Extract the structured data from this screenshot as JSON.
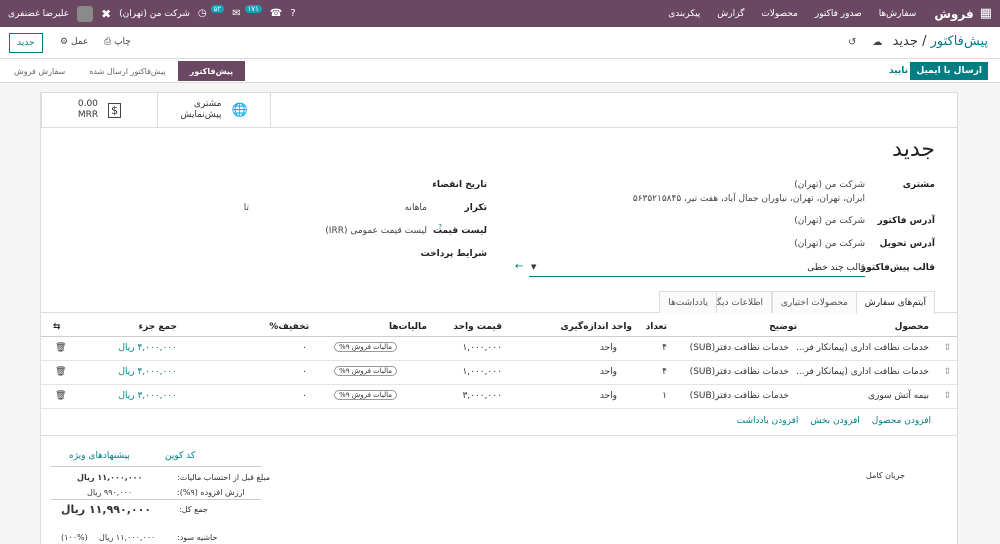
{
  "topbar": {
    "app_name": "فروش",
    "menu": [
      "سفارش‌ها",
      "صدور فاکتور",
      "محصولات",
      "گزارش",
      "پیکربندی"
    ],
    "company": "شرکت من (تهران)",
    "activity_count": "۵۲",
    "message_count": "۱۷۱",
    "user_name": "علیرضا غضنفری"
  },
  "control_panel": {
    "breadcrumb_parent": "پیش‌فاکتور",
    "breadcrumb_sep": "/",
    "breadcrumb_current": "جدید",
    "new_button": "جدید",
    "print_label": "چاپ",
    "action_label": "عمل"
  },
  "statusbar": {
    "send_email": "ارسال با ایمیل",
    "confirm": "تایید",
    "stages": [
      "پیش‌فاکتور",
      "پیش‌فاکتور ارسال شده",
      "سفارش فروش"
    ]
  },
  "smart_buttons": {
    "preview_title": "مشتری",
    "preview_sub": "پیش‌نمایش",
    "amount_value": "0.00",
    "amount_currency": "MRR"
  },
  "form": {
    "title": "جدید",
    "customer_label": "مشتری",
    "customer_value": "شرکت من (تهران)",
    "customer_address": "ایران، تهران، تهران، نیاوران جمال آباد، هفت تیر، ۵۶۳۵۲۱۵۸۴۵",
    "invoice_address_label": "آدرس فاکتور",
    "invoice_address_value": "شرکت من (تهران)",
    "delivery_address_label": "آدرس تحویل",
    "delivery_address_value": "شرکت من (تهران)",
    "template_label": "قالب پیش‌فاکتور",
    "template_value": "قالب چند خطی",
    "expiry_label": "تاریخ انقضاء",
    "recurrence_label": "تکرار",
    "recurrence_value": "ماهانه",
    "recurrence_until": "تا",
    "pricelist_label": "لیست قیمت",
    "pricelist_value": "لیست قیمت عمومی (IRR)",
    "payment_terms_label": "شرایط پرداخت"
  },
  "tabs": [
    "آیتم‌های سفارش",
    "محصولات اختیاری",
    "اطلاعات دیگر",
    "یادداشت‌ها"
  ],
  "table": {
    "headers": [
      "محصول",
      "توضیح",
      "تعداد",
      "واحد اندازه‌گیری",
      "قیمت واحد",
      "مالیات‌ها",
      "تخفیف%",
      "جمع جزء"
    ],
    "rows": [
      {
        "product": "خدمات نظافت اداری (پیمانکار فر...",
        "description": "خدمات نظافت دفتر(SUB)",
        "qty": "۴",
        "uom": "واحد",
        "price": "۱,۰۰۰,۰۰۰",
        "tax": "مالیات فروش ۹%",
        "discount": "۰",
        "subtotal": "۴,۰۰۰,۰۰۰ ریال"
      },
      {
        "product": "خدمات نظافت اداری (پیمانکار فر...",
        "description": "خدمات نظافت دفتر(SUB)",
        "qty": "۴",
        "uom": "واحد",
        "price": "۱,۰۰۰,۰۰۰",
        "tax": "مالیات فروش ۹%",
        "discount": "۰",
        "subtotal": "۴,۰۰۰,۰۰۰ ریال"
      },
      {
        "product": "بیمه آتش سوزی",
        "description": "خدمات نظافت دفتر(SUB)",
        "qty": "۱",
        "uom": "واحد",
        "price": "۳,۰۰۰,۰۰۰",
        "tax": "مالیات فروش ۹%",
        "discount": "۰",
        "subtotal": "۳,۰۰۰,۰۰۰ ریال"
      }
    ]
  },
  "add_links": [
    "افزودن محصول",
    "افزودن بخش",
    "افزودن یادداشت"
  ],
  "footer": {
    "coupon": "کد کوپن",
    "promotions": "پیشنهادهای ویژه",
    "untaxed_label": "مبلغ قبل از احتساب مالیات:",
    "untaxed_value": "۱۱,۰۰۰,۰۰۰ ریال",
    "vat_label": "ارزش افزوده (۹%):",
    "vat_value": "۹۹۰,۰۰۰ ریال",
    "total_label": "جمع کل:",
    "total_value": "۱۱,۹۹۰,۰۰۰ ریال",
    "margin_label": "حاشیه سود:",
    "margin_value": "۱۱,۰۰۰,۰۰۰ ریال",
    "margin_percent": "(۱۰۰%)",
    "full_flow": "جریان کامل"
  }
}
